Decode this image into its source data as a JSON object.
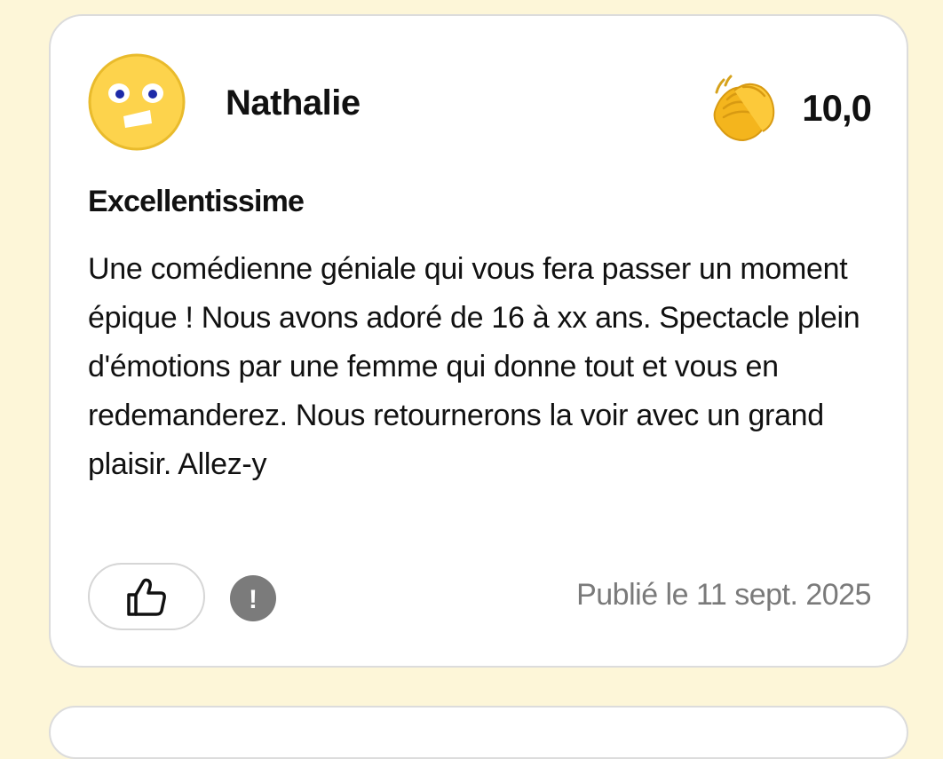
{
  "review": {
    "username": "Nathalie",
    "avatar": {
      "icon": "smiley-avatar-icon",
      "color": "#fdd34c"
    },
    "rating": {
      "icon": "clapping-hands-icon",
      "score": "10,0"
    },
    "title": "Excellentissime",
    "body": "Une comédienne géniale qui vous fera passer un moment épique ! Nous avons adoré de 16 à xx ans. Spectacle plein d'émotions par une femme qui donne tout et vous en redemanderez. Nous retournerons la voir avec un grand plaisir. Allez-y",
    "actions": {
      "like_icon": "thumbs-up-icon",
      "report_icon": "exclamation-icon",
      "report_glyph": "!"
    },
    "published": "Publié le 11 sept. 2025"
  },
  "colors": {
    "background": "#fdf6d8",
    "card": "#ffffff",
    "accent_yellow": "#fdd34c",
    "muted_text": "#7a7a7a"
  }
}
